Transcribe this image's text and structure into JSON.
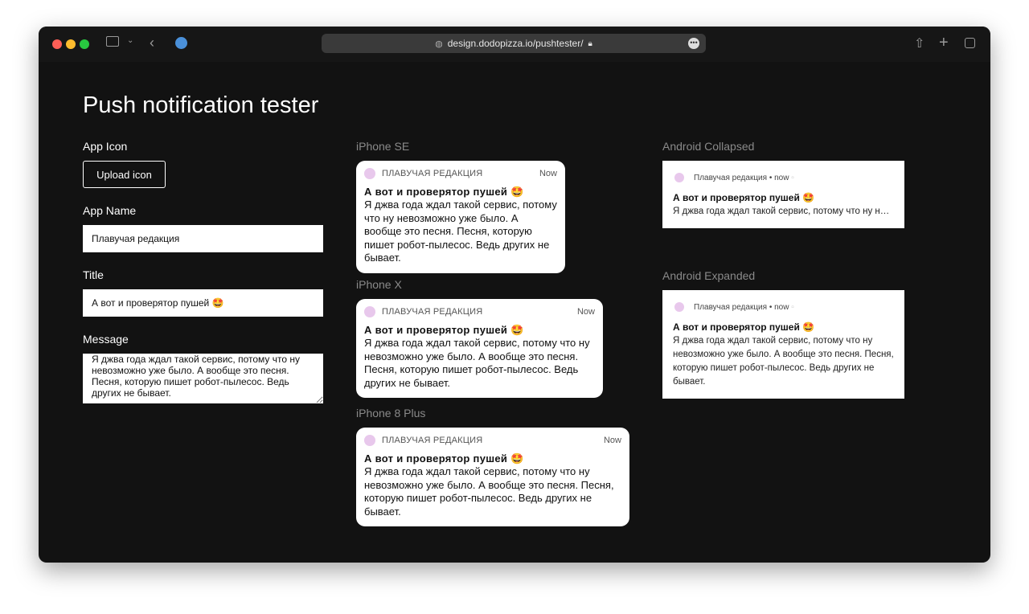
{
  "browser": {
    "url": "design.dodopizza.io/pushtester/",
    "icons": [
      "sidebar-icon",
      "chevron-down-icon",
      "back-icon",
      "extension-icon",
      "lock-icon",
      "more-icon",
      "share-icon",
      "new-tab-icon",
      "tabs-icon"
    ]
  },
  "page": {
    "title": "Push notification tester"
  },
  "form": {
    "app_icon_label": "App Icon",
    "upload_label": "Upload icon",
    "app_name_label": "App Name",
    "app_name_value": "Плавучая редакция",
    "title_label": "Title",
    "title_value": "А вот и проверятор пушей 🤩",
    "message_label": "Message",
    "message_value": "Я джва года ждал такой сервис, потому что ну невозможно уже было. А вообще это песня. Песня, которую пишет робот-пылесос. Ведь других не бывает."
  },
  "notification": {
    "app_upper": "ПЛАВУЧАЯ РЕДАКЦИЯ",
    "app": "Плавучая редакция",
    "ios_time": "Now",
    "android_time": "• now",
    "title": "А вот и проверятор пушей 🤩",
    "message": "Я джва года ждал такой сервис, потому что ну невозможно уже было. А вообще это песня. Песня, которую пишет робот-пылесос. Ведь других не бывает."
  },
  "previews": {
    "iphone_se": "iPhone SE",
    "iphone_x": "iPhone X",
    "iphone_8_plus": "iPhone 8 Plus",
    "android_collapsed": "Android Collapsed",
    "android_expanded": "Android Expanded"
  }
}
